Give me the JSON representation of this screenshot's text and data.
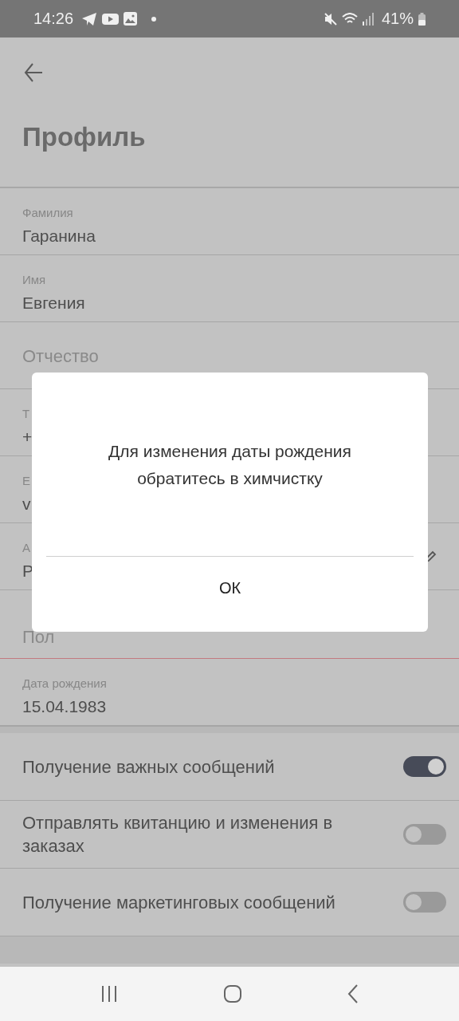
{
  "status_bar": {
    "time": "14:26",
    "battery": "41%"
  },
  "header": {
    "title": "Профиль"
  },
  "fields": [
    {
      "kind": "filled",
      "label": "Фамилия",
      "value": "Гаранина",
      "invalid": false
    },
    {
      "kind": "filled",
      "label": "Имя",
      "value": "Евгения",
      "invalid": false
    },
    {
      "kind": "empty",
      "placeholder": "Отчество",
      "invalid": false
    },
    {
      "kind": "filled",
      "label": "Т",
      "value": "+",
      "invalid": false
    },
    {
      "kind": "filled",
      "label": "Е",
      "value": "v",
      "invalid": false
    },
    {
      "kind": "editable",
      "label": "А",
      "value": "Р",
      "invalid": false
    },
    {
      "kind": "empty",
      "placeholder": "Пол",
      "invalid": true
    },
    {
      "kind": "filled",
      "label": "Дата рождения",
      "value": "15.04.1983",
      "invalid": false
    }
  ],
  "toggles": [
    {
      "label": "Получение важных сообщений",
      "on": true
    },
    {
      "label": "Отправлять квитанцию и изменения в заказах",
      "on": false
    },
    {
      "label": "Получение маркетинговых сообщений",
      "on": false
    }
  ],
  "dialog": {
    "message": "Для изменения даты рождения обратитесь в химчистку",
    "button": "ОК"
  }
}
